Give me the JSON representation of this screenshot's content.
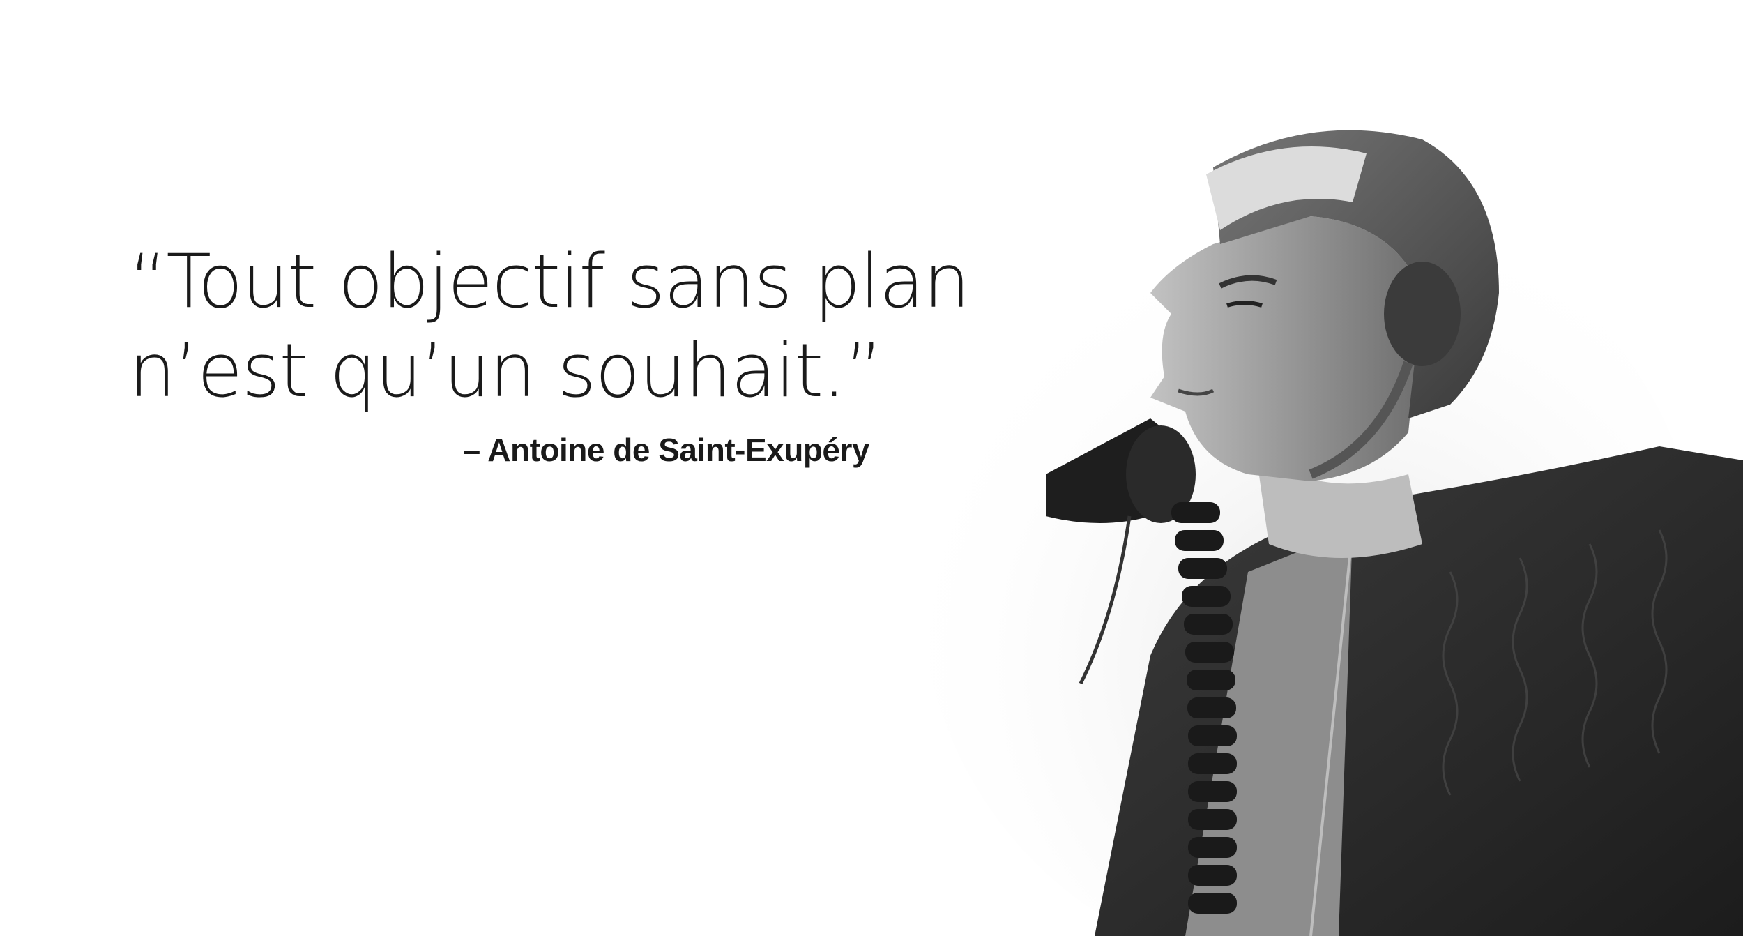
{
  "quote": {
    "lines": [
      "“Tout objectif sans plan",
      "n’est qu’un souhait.”"
    ],
    "author": "– Antoine de Saint-Exupéry"
  },
  "portrait": {
    "icon": "aviator-portrait-icon",
    "colors": {
      "background": "#ffffff",
      "text": "#1a1a1a",
      "jacket": "#2b2b2b",
      "skin": "#9a9a9a",
      "helmet": "#5a5a5a",
      "fleece": "#d8d8d8"
    }
  }
}
